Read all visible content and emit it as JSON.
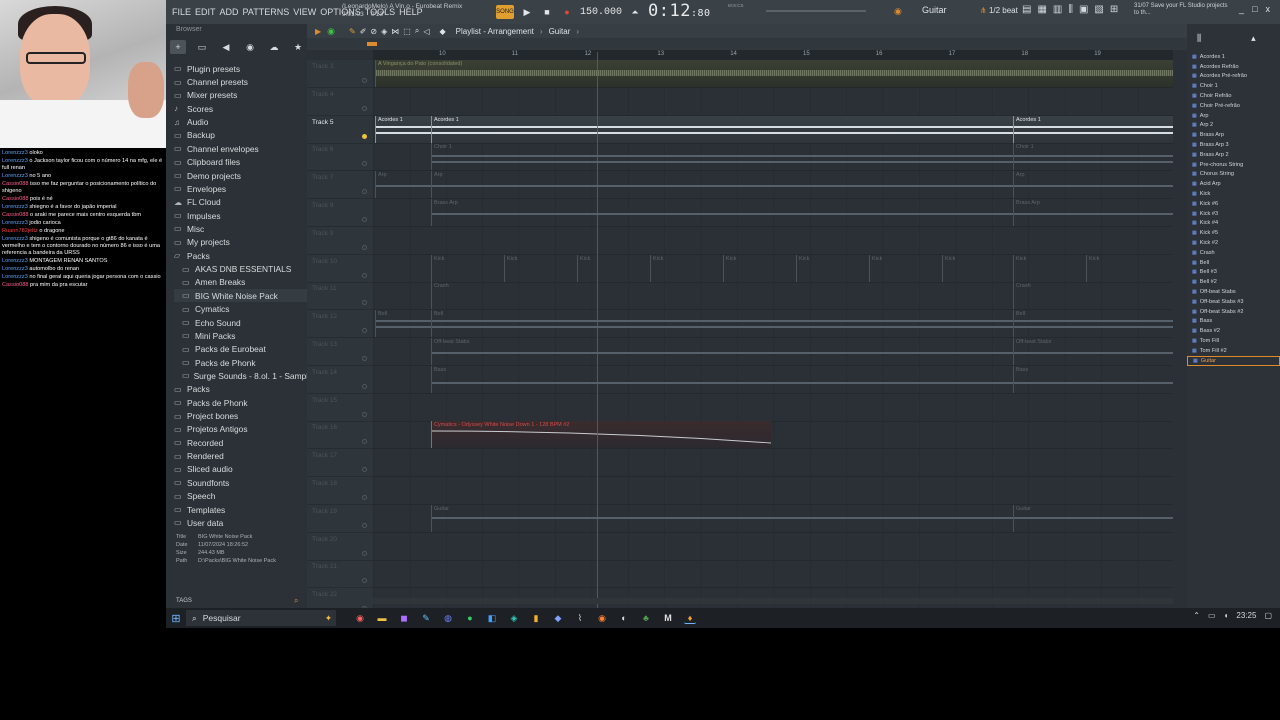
{
  "menu": [
    "FILE",
    "EDIT",
    "ADD",
    "PATTERNS",
    "VIEW",
    "OPTIONS",
    "TOOLS",
    "HELP"
  ],
  "song_info": {
    "line1": "(LeonardoMelo) A Vin.o - Eurobeat Remix",
    "line2": "9:01:03",
    "line3": "0'13\""
  },
  "transport": {
    "bpm": "150.000",
    "time_main": "0:12",
    "time_frac": "80",
    "time_unit": "M:S:CS"
  },
  "header": {
    "channel": "Guitar",
    "snap": "1/2 beat",
    "hint": "31/07 Save your FL Studio projects to th...",
    "win_controls": [
      "_",
      "□",
      "x"
    ]
  },
  "browser": {
    "title": "Browser",
    "tools": [
      "+",
      "doc",
      "◀",
      "◉",
      "☁",
      "★"
    ],
    "items": [
      {
        "label": "Plugin presets",
        "icon": "folder-icon",
        "sub": false
      },
      {
        "label": "Channel presets",
        "icon": "folder-icon",
        "sub": false
      },
      {
        "label": "Mixer presets",
        "icon": "folder-icon",
        "sub": false
      },
      {
        "label": "Scores",
        "icon": "note-icon",
        "sub": false
      },
      {
        "label": "Audio",
        "icon": "audio-icon",
        "sub": false
      },
      {
        "label": "Backup",
        "icon": "folder-icon",
        "sub": false
      },
      {
        "label": "Channel envelopes",
        "icon": "folder-icon",
        "sub": false
      },
      {
        "label": "Clipboard files",
        "icon": "folder-icon",
        "sub": false
      },
      {
        "label": "Demo projects",
        "icon": "folder-icon",
        "sub": false
      },
      {
        "label": "Envelopes",
        "icon": "folder-icon",
        "sub": false
      },
      {
        "label": "FL Cloud",
        "icon": "cloud-icon",
        "sub": false
      },
      {
        "label": "Impulses",
        "icon": "folder-icon",
        "sub": false
      },
      {
        "label": "Misc",
        "icon": "folder-icon",
        "sub": false
      },
      {
        "label": "My projects",
        "icon": "folder-icon",
        "sub": false
      },
      {
        "label": "Packs",
        "icon": "folder-open-icon",
        "sub": false
      },
      {
        "label": "AKAS DNB ESSENTIALS",
        "icon": "folder-icon",
        "sub": true
      },
      {
        "label": "Amen Breaks",
        "icon": "folder-icon",
        "sub": true
      },
      {
        "label": "BIG White Noise Pack",
        "icon": "folder-icon",
        "sub": true
      },
      {
        "label": "Cymatics",
        "icon": "folder-icon",
        "sub": true
      },
      {
        "label": "Echo Sound",
        "icon": "folder-icon",
        "sub": true
      },
      {
        "label": "Mini Packs",
        "icon": "folder-icon",
        "sub": true
      },
      {
        "label": "Packs de Eurobeat",
        "icon": "folder-icon",
        "sub": true
      },
      {
        "label": "Packs de Phonk",
        "icon": "folder-icon",
        "sub": true
      },
      {
        "label": "Surge Sounds - 8.ol. 1 - Samples",
        "icon": "folder-icon",
        "sub": true
      },
      {
        "label": "Packs",
        "icon": "folder-icon",
        "sub": false
      },
      {
        "label": "Packs de Phonk",
        "icon": "folder-icon",
        "sub": false
      },
      {
        "label": "Project bones",
        "icon": "folder-icon",
        "sub": false
      },
      {
        "label": "Projetos Antigos",
        "icon": "folder-icon",
        "sub": false
      },
      {
        "label": "Recorded",
        "icon": "folder-icon",
        "sub": false
      },
      {
        "label": "Rendered",
        "icon": "folder-icon",
        "sub": false
      },
      {
        "label": "Sliced audio",
        "icon": "folder-icon",
        "sub": false
      },
      {
        "label": "Soundfonts",
        "icon": "folder-icon",
        "sub": false
      },
      {
        "label": "Speech",
        "icon": "folder-icon",
        "sub": false
      },
      {
        "label": "Templates",
        "icon": "folder-icon",
        "sub": false
      },
      {
        "label": "User data",
        "icon": "folder-icon",
        "sub": false
      }
    ],
    "file_info": {
      "title_k": "Title",
      "title_v": "BIG White Noise Pack",
      "date_k": "Date",
      "date_v": "11/07/2024 18:26:52",
      "size_k": "Size",
      "size_v": "244.43 MB",
      "path_k": "Path",
      "path_v": "D:\\Packs\\BIG White Noise Pack"
    },
    "tags_label": "TAGS"
  },
  "playlist": {
    "breadcrumb": [
      "Playlist - Arrangement",
      "Guitar"
    ],
    "bars": [
      "10",
      "11",
      "12",
      "13",
      "14",
      "15",
      "16",
      "17",
      "18",
      "19"
    ],
    "tracks": [
      {
        "name": "Track 3",
        "active": false
      },
      {
        "name": "Track 4",
        "active": false
      },
      {
        "name": "Track 5",
        "active": true
      },
      {
        "name": "Track 6",
        "active": false
      },
      {
        "name": "Track 7",
        "active": false
      },
      {
        "name": "Track 8",
        "active": false
      },
      {
        "name": "Track 9",
        "active": false
      },
      {
        "name": "Track 10",
        "active": false
      },
      {
        "name": "Track 11",
        "active": false
      },
      {
        "name": "Track 12",
        "active": false
      },
      {
        "name": "Track 13",
        "active": false
      },
      {
        "name": "Track 14",
        "active": false
      },
      {
        "name": "Track 15",
        "active": false
      },
      {
        "name": "Track 16",
        "active": false
      },
      {
        "name": "Track 17",
        "active": false
      },
      {
        "name": "Track 18",
        "active": false
      },
      {
        "name": "Track 19",
        "active": false
      },
      {
        "name": "Track 20",
        "active": false
      },
      {
        "name": "Track 21",
        "active": false
      },
      {
        "name": "Track 22",
        "active": false
      }
    ],
    "clips": {
      "vocal": "A Vingança do Pato (consolidated)",
      "acordes": "Acordes 1",
      "choir": "Choir 1",
      "arp": "Arp",
      "brass": "Brass Arp",
      "kick": "Kick",
      "crash": "Crash",
      "bell": "Bell",
      "offbeat": "Off-beat Stabs",
      "bass": "Bass",
      "cymatics": "Cymatics - Odyssey White Noise Down 1 - 128 BPM #2",
      "guitar": "Guitar"
    }
  },
  "picker": {
    "items": [
      "Acordes 1",
      "Acordes Refrão",
      "Acordes Pré-refrão",
      "Choir 1",
      "Choir Refrão",
      "Choir Pré-refrão",
      "Arp",
      "Arp 2",
      "Brass Arp",
      "Brass Arp 3",
      "Brass Arp 2",
      "Pre-chorus String",
      "Chorus String",
      "Acid Arp",
      "Kick",
      "Kick #6",
      "Kick #3",
      "Kick #4",
      "Kick #5",
      "Kick #2",
      "Crash",
      "Bell",
      "Bell #3",
      "Bell #2",
      "Off-beat Stabs",
      "Off-beat Stabs #3",
      "Off-beat Stabs #2",
      "Bass",
      "Bass #2",
      "Tom Fill",
      "Tom Fill #2",
      "Guitar"
    ],
    "selected": "Guitar"
  },
  "chat": [
    {
      "user": "Lorenzzz3",
      "text": "oloko",
      "cls": "u1"
    },
    {
      "user": "Lorenzzz3",
      "text": "o Jackson taylor ficou com o número 14 na mfg, ele é full renan",
      "cls": "u1"
    },
    {
      "user": "Lorenzzz3",
      "text": "no 5 ano",
      "cls": "u1"
    },
    {
      "user": "Cassio088",
      "text": "isso me faz perguntar o posicionamento político do shigeno",
      "cls": "u2"
    },
    {
      "user": "Cassio088",
      "text": "pois é né",
      "cls": "u2"
    },
    {
      "user": "Lorenzzz3",
      "text": "shiegno é a favor do japão imperial",
      "cls": "u1"
    },
    {
      "user": "Cassio088",
      "text": "o araki me parece mais centro esquerda tbm",
      "cls": "u2"
    },
    {
      "user": "Lorenzzz3",
      "text": "jodio carioca",
      "cls": "u1"
    },
    {
      "user": "Ruann782jeltz",
      "text": "o dragone",
      "cls": "u3"
    },
    {
      "user": "Lorenzzz3",
      "text": "shigeno é comunista porque o gt86 do kanata é vermelho e tem o contorno dourado no número 86 e isso é uma referencia a bandeira da URSS",
      "cls": "u1"
    },
    {
      "user": "Lorenzzz3",
      "text": "MONTAGEM RENAN SANTOS",
      "cls": "u1"
    },
    {
      "user": "Lorenzzz3",
      "text": "automolbo do renan",
      "cls": "u1"
    },
    {
      "user": "Lorenzzz3",
      "text": "no final geral aqui queria jogar persona com o cassio",
      "cls": "u1"
    },
    {
      "user": "Cassio088",
      "text": "pra mim da pra escutar",
      "cls": "u2"
    }
  ],
  "taskbar": {
    "search_placeholder": "Pesquisar",
    "clock": "23:25"
  },
  "colors": {
    "accent_orange": "#e08a2e",
    "record_red": "#e0463a",
    "clip_red": "#d34a4a"
  }
}
